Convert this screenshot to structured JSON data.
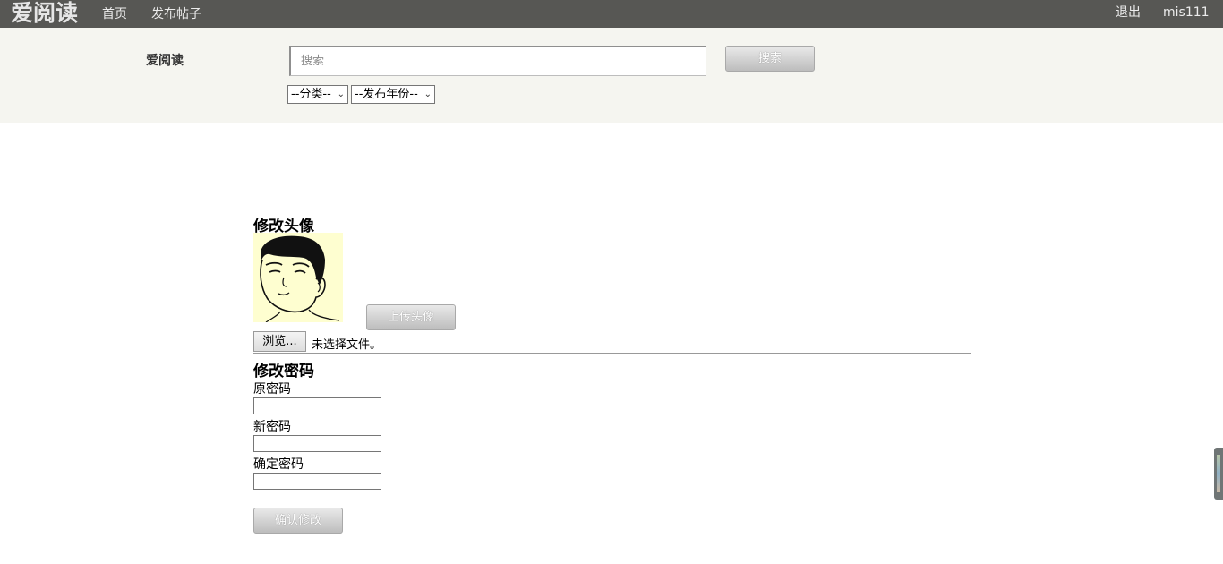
{
  "topbar": {
    "brand": "爱阅读",
    "nav_home": "首页",
    "nav_post": "发布帖子",
    "nav_logout": "退出",
    "nav_user": "mis111",
    "background_color": "#575754"
  },
  "search": {
    "title": "爱阅读",
    "placeholder": "搜索",
    "button_label": "搜索",
    "category_select": "--分类--",
    "year_select": "--发布年份--",
    "background_color": "#f5f5f0"
  },
  "avatar_section": {
    "heading": "修改头像",
    "upload_button": "上传头像",
    "browse_button": "浏览...",
    "file_status": "未选择文件。"
  },
  "password_section": {
    "heading": "修改密码",
    "old_label": "原密码",
    "new_label": "新密码",
    "confirm_label": "确定密码",
    "submit_button": "确认修改"
  }
}
